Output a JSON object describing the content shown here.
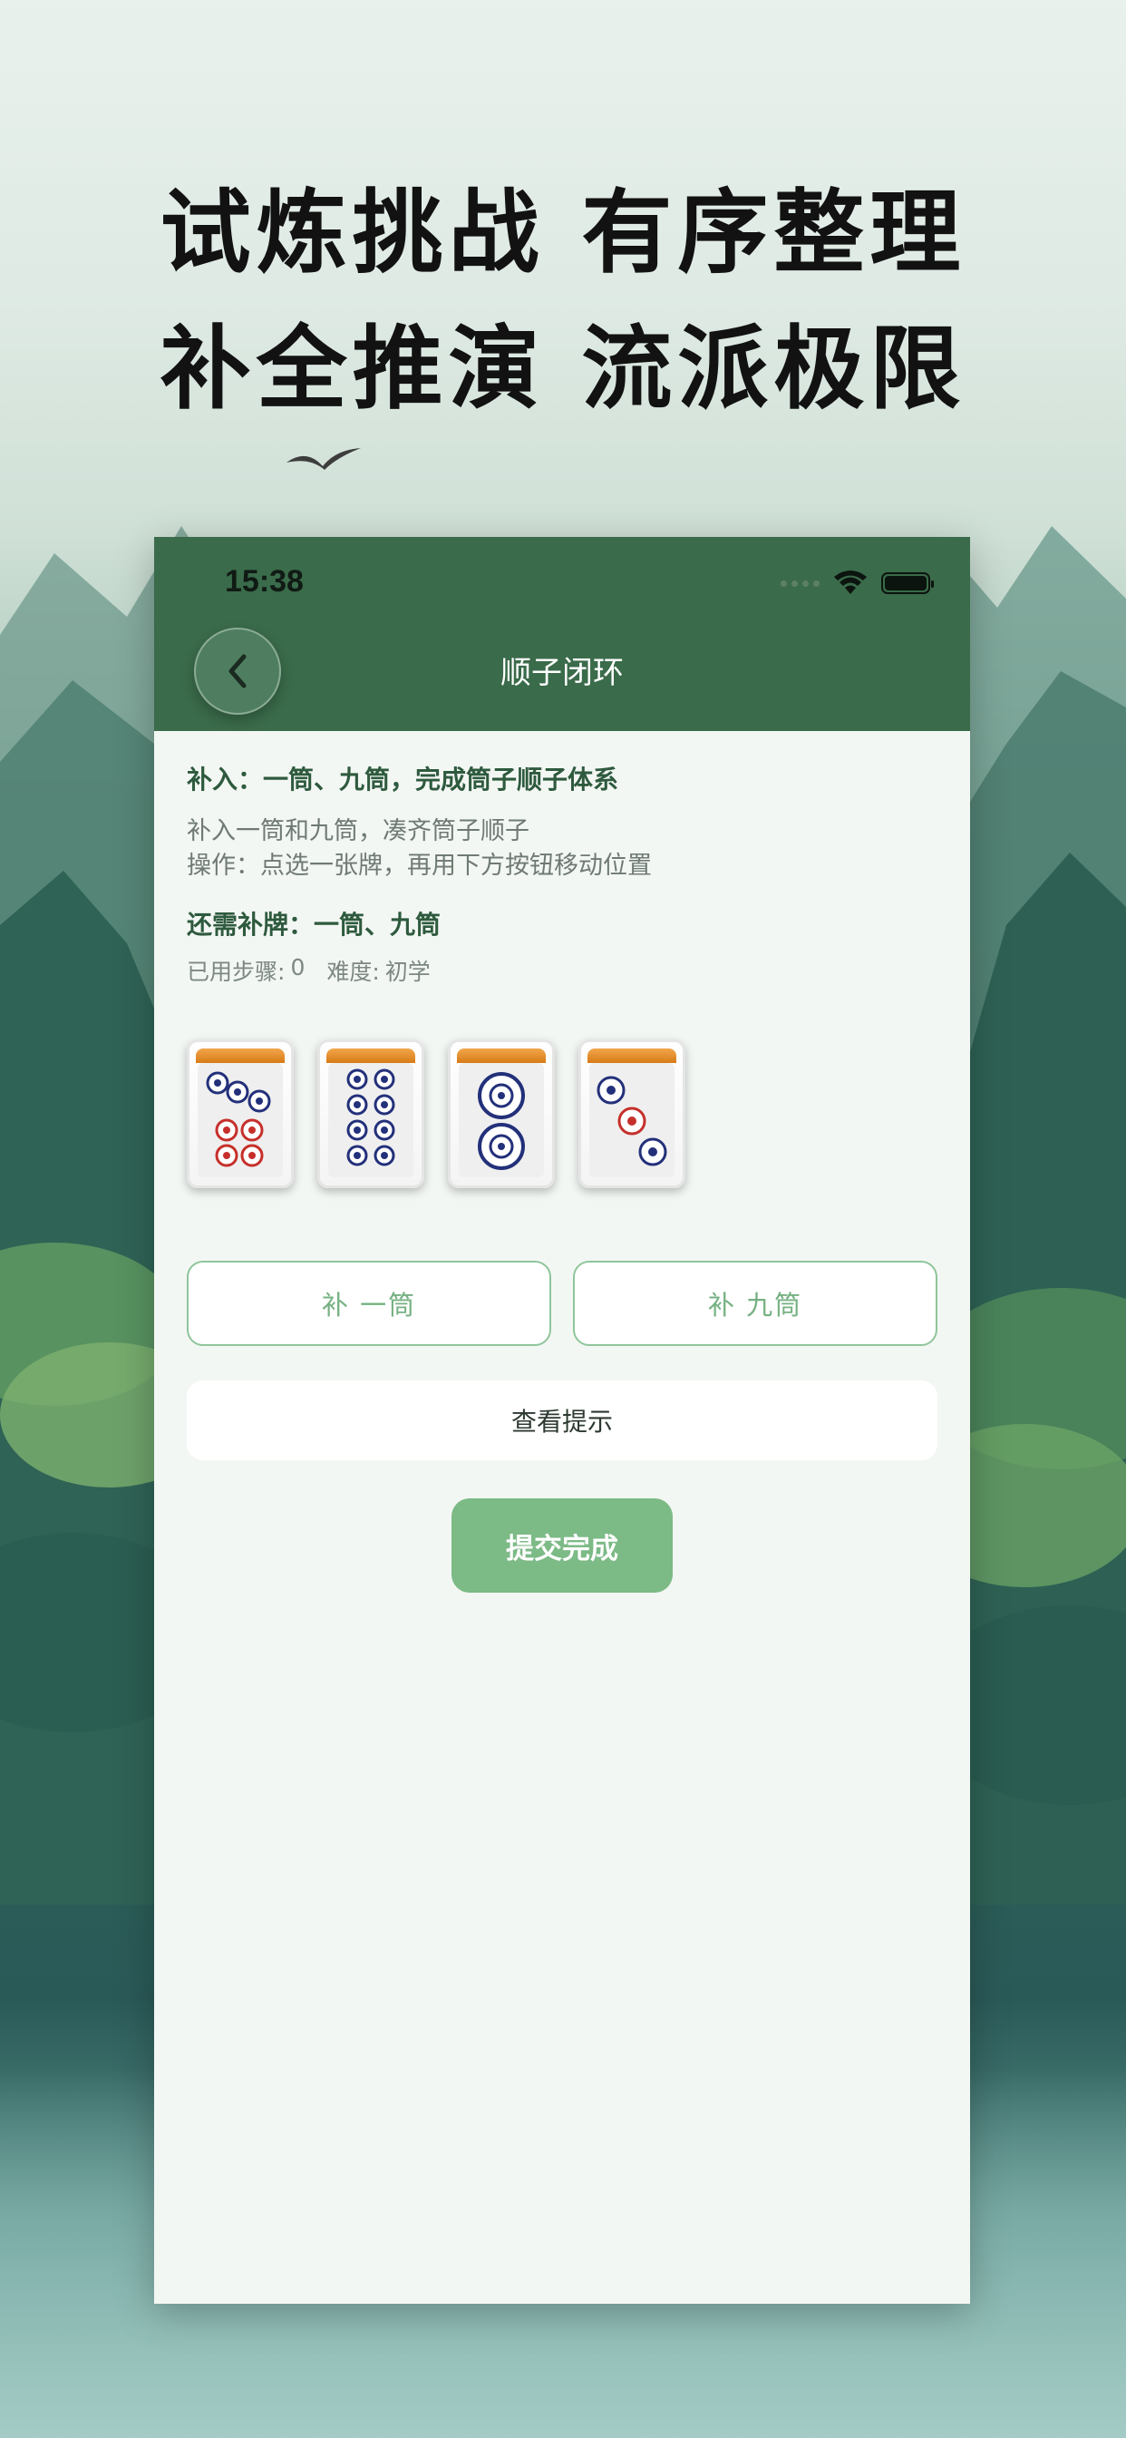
{
  "headline": {
    "line1": "试炼挑战 有序整理",
    "line2": "补全推演 流派极限"
  },
  "status_bar": {
    "time": "15:38"
  },
  "nav": {
    "title": "顺子闭环",
    "back_icon": "chevron-left-icon"
  },
  "puzzle": {
    "goal": "补入：一筒、九筒，完成筒子顺子体系",
    "description_line1": "补入一筒和九筒，凑齐筒子顺子",
    "description_line2": "操作：点选一张牌，再用下方按钮移动位置",
    "need": "还需补牌：一筒、九筒",
    "steps_label": "已用步骤:",
    "steps_value": "0",
    "difficulty_label": "难度:",
    "difficulty_value": "初学"
  },
  "tiles": [
    {
      "name": "七筒",
      "icon": "seven-circles-tile"
    },
    {
      "name": "八筒",
      "icon": "eight-circles-tile"
    },
    {
      "name": "二筒",
      "icon": "two-circles-tile"
    },
    {
      "name": "三筒",
      "icon": "three-circles-tile"
    }
  ],
  "actions": {
    "add_one": "补 一筒",
    "add_nine": "补 九筒",
    "hint": "查看提示",
    "submit": "提交完成"
  },
  "colors": {
    "nav_green": "#3a6b4a",
    "accent_green": "#7cba86",
    "outline_green": "#8fc59b"
  }
}
